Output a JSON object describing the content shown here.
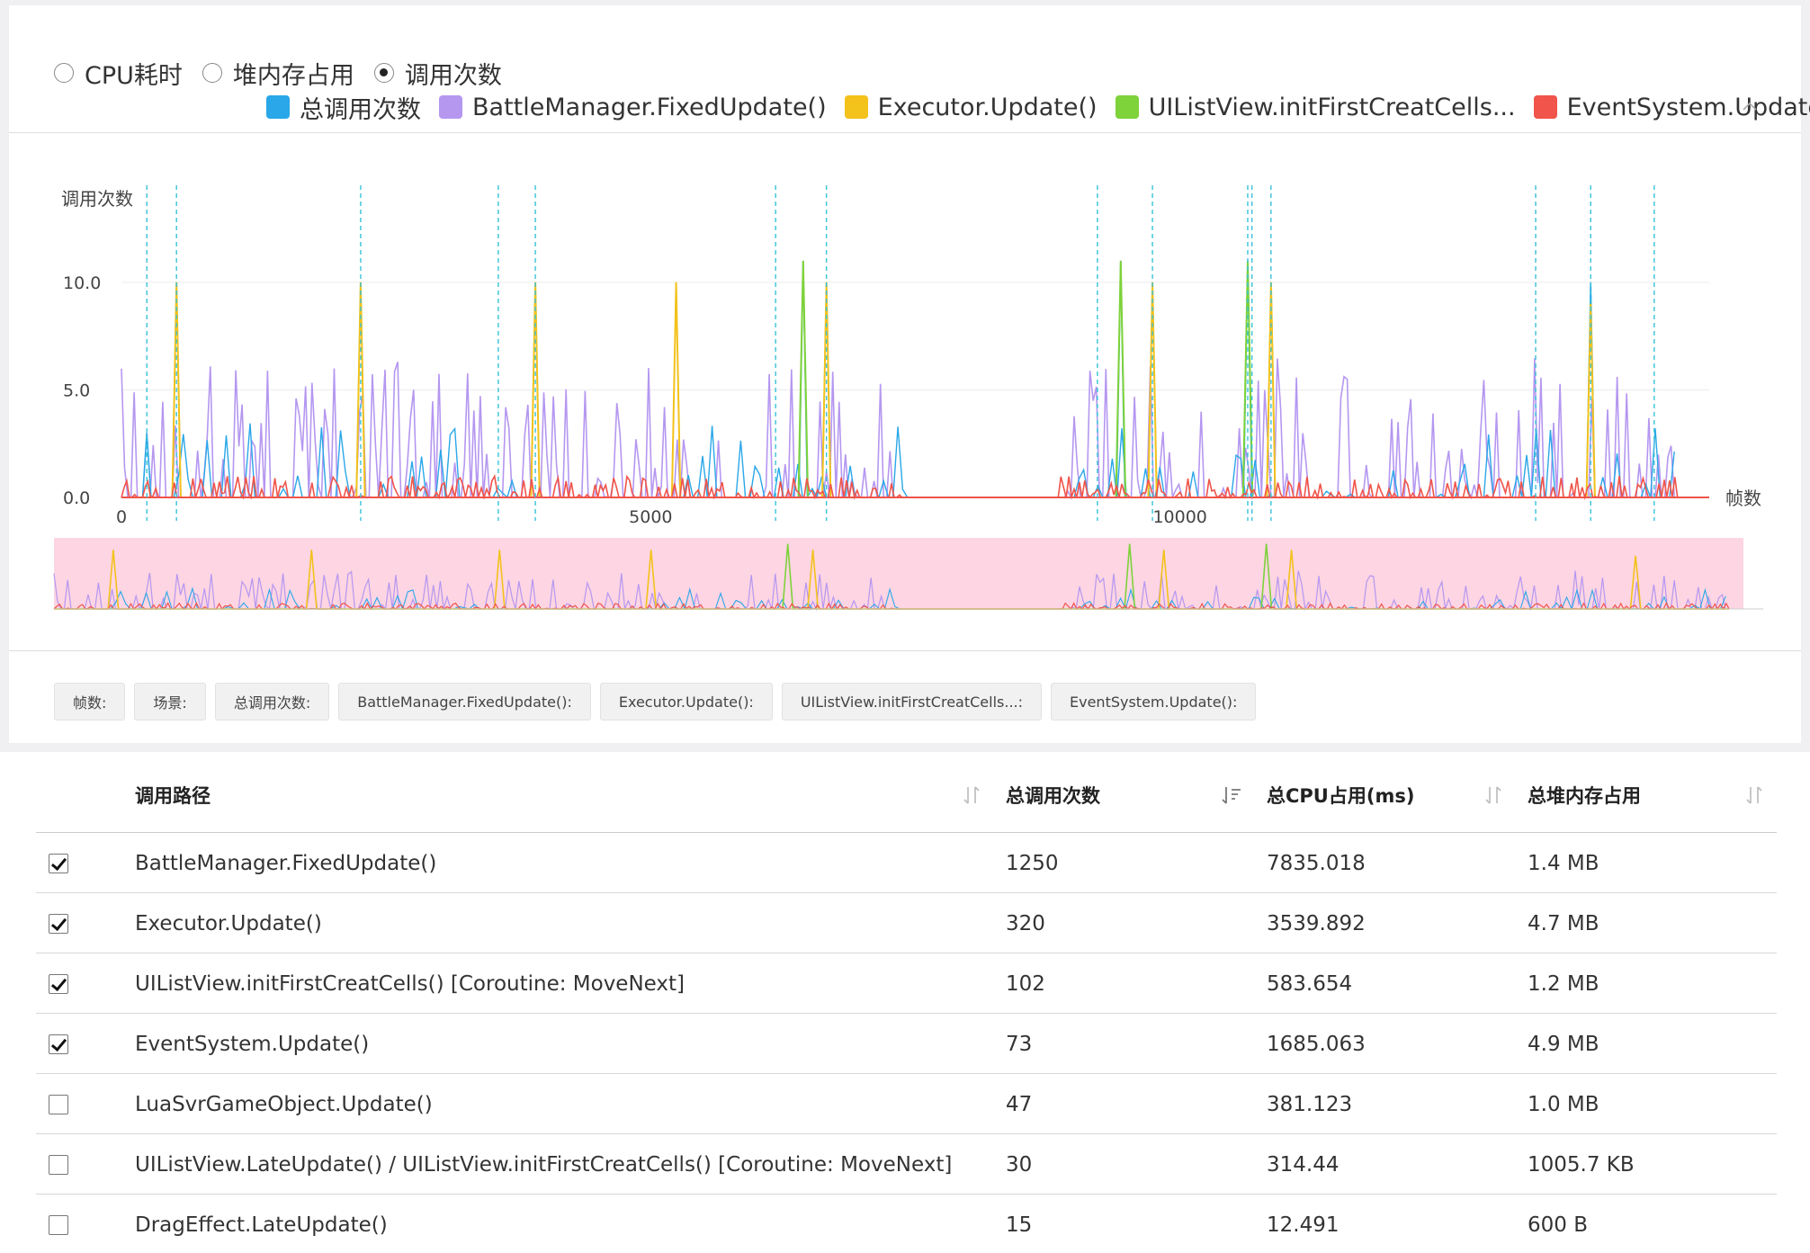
{
  "metric_modes": [
    {
      "label": "CPU耗时",
      "selected": false
    },
    {
      "label": "堆内存占用",
      "selected": false
    },
    {
      "label": "调用次数",
      "selected": true
    }
  ],
  "legend": [
    {
      "label": "总调用次数",
      "color": "#2aa7e8"
    },
    {
      "label": "BattleManager.FixedUpdate()",
      "color": "#b597f0"
    },
    {
      "label": "Executor.Update()",
      "color": "#f3c21b"
    },
    {
      "label": "UIListView.initFirstCreatCells...",
      "color": "#7ed23a"
    },
    {
      "label": "EventSystem.Update()",
      "color": "#f0544a"
    }
  ],
  "chart_data": {
    "type": "line",
    "ylabel": "调用次数",
    "xlabel": "帧数",
    "xlim": [
      0,
      15000
    ],
    "ylim": [
      0,
      12
    ],
    "yticks": [
      "0.0",
      "5.0",
      "10.0"
    ],
    "ytick_values": [
      0,
      5,
      10
    ],
    "xticks": [
      "0",
      "5000",
      "10000"
    ],
    "xtick_values": [
      0,
      5000,
      10000
    ],
    "marker_frames": [
      240,
      520,
      2260,
      3560,
      3910,
      6180,
      6660,
      9220,
      9740,
      10640,
      10680,
      10860,
      13360,
      13880,
      14480
    ],
    "spikes": {
      "总调用次数": [
        [
          240,
          3
        ],
        [
          520,
          10
        ],
        [
          2260,
          10
        ],
        [
          3910,
          10
        ],
        [
          6440,
          11
        ],
        [
          6660,
          10
        ],
        [
          9440,
          11
        ],
        [
          9740,
          10
        ],
        [
          10640,
          11
        ],
        [
          10860,
          10
        ],
        [
          13880,
          10
        ]
      ],
      "Executor.Update()": [
        [
          520,
          10
        ],
        [
          2260,
          10
        ],
        [
          3910,
          10
        ],
        [
          5240,
          10
        ],
        [
          6660,
          10
        ],
        [
          9740,
          10
        ],
        [
          10860,
          10
        ],
        [
          13880,
          9
        ]
      ],
      "UIListView.initFirstCreatCells...": [
        [
          6440,
          11
        ],
        [
          9440,
          11
        ],
        [
          10640,
          11
        ]
      ]
    },
    "series": [
      {
        "name": "总调用次数",
        "color": "#2aa7e8"
      },
      {
        "name": "BattleManager.FixedUpdate()",
        "color": "#b597f0"
      },
      {
        "name": "Executor.Update()",
        "color": "#f3c21b"
      },
      {
        "name": "UIListView.initFirstCreatCells...",
        "color": "#7ed23a"
      },
      {
        "name": "EventSystem.Update()",
        "color": "#f0544a"
      }
    ],
    "grid": true,
    "zoom_slider": {
      "start": 0,
      "end": 100,
      "color": "#fdd5e3"
    }
  },
  "tooltip_chips": [
    "帧数:",
    "场景:",
    "总调用次数:",
    "BattleManager.FixedUpdate():",
    "Executor.Update():",
    "UIListView.initFirstCreatCells...:",
    "EventSystem.Update():"
  ],
  "table": {
    "headers": [
      "调用路径",
      "总调用次数",
      "总CPU占用(ms)",
      "总堆内存占用"
    ],
    "rows": [
      {
        "checked": true,
        "path": "BattleManager.FixedUpdate()",
        "calls": "1250",
        "cpu": "7835.018",
        "mem": "1.4 MB"
      },
      {
        "checked": true,
        "path": "Executor.Update()",
        "calls": "320",
        "cpu": "3539.892",
        "mem": "4.7 MB"
      },
      {
        "checked": true,
        "path": "UIListView.initFirstCreatCells() [Coroutine: MoveNext]",
        "calls": "102",
        "cpu": "583.654",
        "mem": "1.2 MB"
      },
      {
        "checked": true,
        "path": "EventSystem.Update()",
        "calls": "73",
        "cpu": "1685.063",
        "mem": "4.9 MB"
      },
      {
        "checked": false,
        "path": "LuaSvrGameObject.Update()",
        "calls": "47",
        "cpu": "381.123",
        "mem": "1.0 MB"
      },
      {
        "checked": false,
        "path": "UIListView.LateUpdate() / UIListView.initFirstCreatCells() [Coroutine: MoveNext]",
        "calls": "30",
        "cpu": "314.44",
        "mem": "1005.7 KB"
      },
      {
        "checked": false,
        "path": "DragEffect.LateUpdate()",
        "calls": "15",
        "cpu": "12.491",
        "mem": "600 B"
      }
    ]
  }
}
